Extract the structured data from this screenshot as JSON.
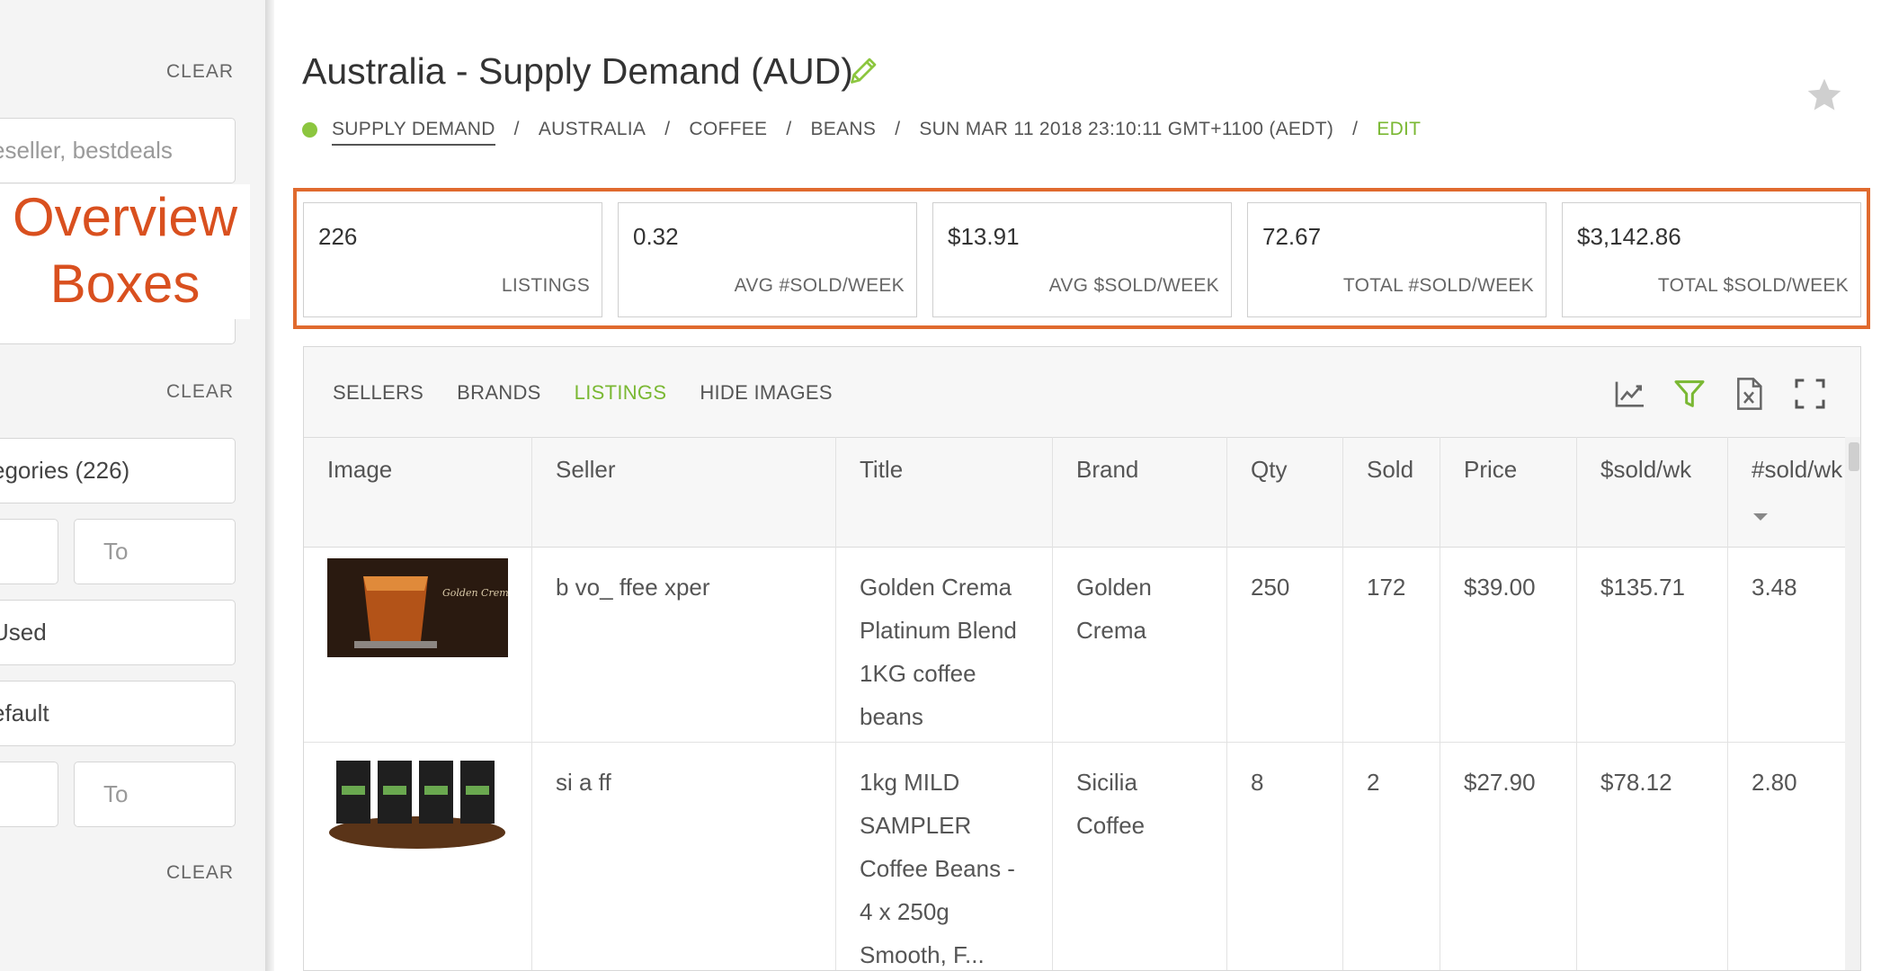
{
  "sidebar": {
    "clear_label": "CLEAR",
    "seller_input_placeholder": "eseller, bestdeals",
    "categories_value": "egories (226)",
    "range1_to_placeholder": "To",
    "condition_value": " Used",
    "sort_value": "efault",
    "range2_to_placeholder": "To"
  },
  "overlay": {
    "line1": "Overview",
    "line2": "Boxes"
  },
  "header": {
    "title": "Australia - Supply Demand (AUD)",
    "breadcrumb": [
      "SUPPLY DEMAND",
      "AUSTRALIA",
      "COFFEE",
      "BEANS",
      "SUN MAR 11 2018 23:10:11 GMT+1100 (AEDT)"
    ],
    "separator": "/",
    "edit_label": "EDIT",
    "status_color": "#8cc63f"
  },
  "overview": [
    {
      "value": "226",
      "label": "LISTINGS"
    },
    {
      "value": "0.32",
      "label": "AVG #SOLD/WEEK"
    },
    {
      "value": "$13.91",
      "label": "AVG $SOLD/WEEK"
    },
    {
      "value": "72.67",
      "label": "TOTAL #SOLD/WEEK"
    },
    {
      "value": "$3,142.86",
      "label": "TOTAL $SOLD/WEEK"
    }
  ],
  "tabs": [
    {
      "label": "SELLERS",
      "active": false
    },
    {
      "label": "BRANDS",
      "active": false
    },
    {
      "label": "LISTINGS",
      "active": true
    },
    {
      "label": "HIDE IMAGES",
      "active": false
    }
  ],
  "toolbar_icons": [
    "line-chart-icon",
    "filter-icon",
    "excel-export-icon",
    "fullscreen-icon"
  ],
  "table": {
    "columns": [
      "Image",
      "Seller",
      "Title",
      "Brand",
      "Qty",
      "Sold",
      "Price",
      "$sold/wk",
      "#sold/wk"
    ],
    "rows": [
      {
        "image": "espresso-shot-image",
        "seller": "b  vo_   ffee   xper",
        "title": [
          "Golden Crema",
          "Platinum Blend",
          "1KG coffee",
          "beans"
        ],
        "brand": [
          "Golden",
          "Crema"
        ],
        "qty": "250",
        "sold": "172",
        "price": "$39.00",
        "sold_dollar_wk": "$135.71",
        "sold_num_wk": "3.48"
      },
      {
        "image": "coffee-bags-image",
        "seller": "si   a   ff",
        "title": [
          "1kg MILD",
          "SAMPLER",
          "Coffee Beans -",
          "4 x 250g",
          "Smooth, F..."
        ],
        "brand": [
          "Sicilia",
          "Coffee"
        ],
        "qty": "8",
        "sold": "2",
        "price": "$27.90",
        "sold_dollar_wk": "$78.12",
        "sold_num_wk": "2.80"
      }
    ]
  },
  "colors": {
    "accent_green": "#7ab833",
    "highlight_orange": "#e06a2e",
    "annotation_red": "#d9501f"
  }
}
